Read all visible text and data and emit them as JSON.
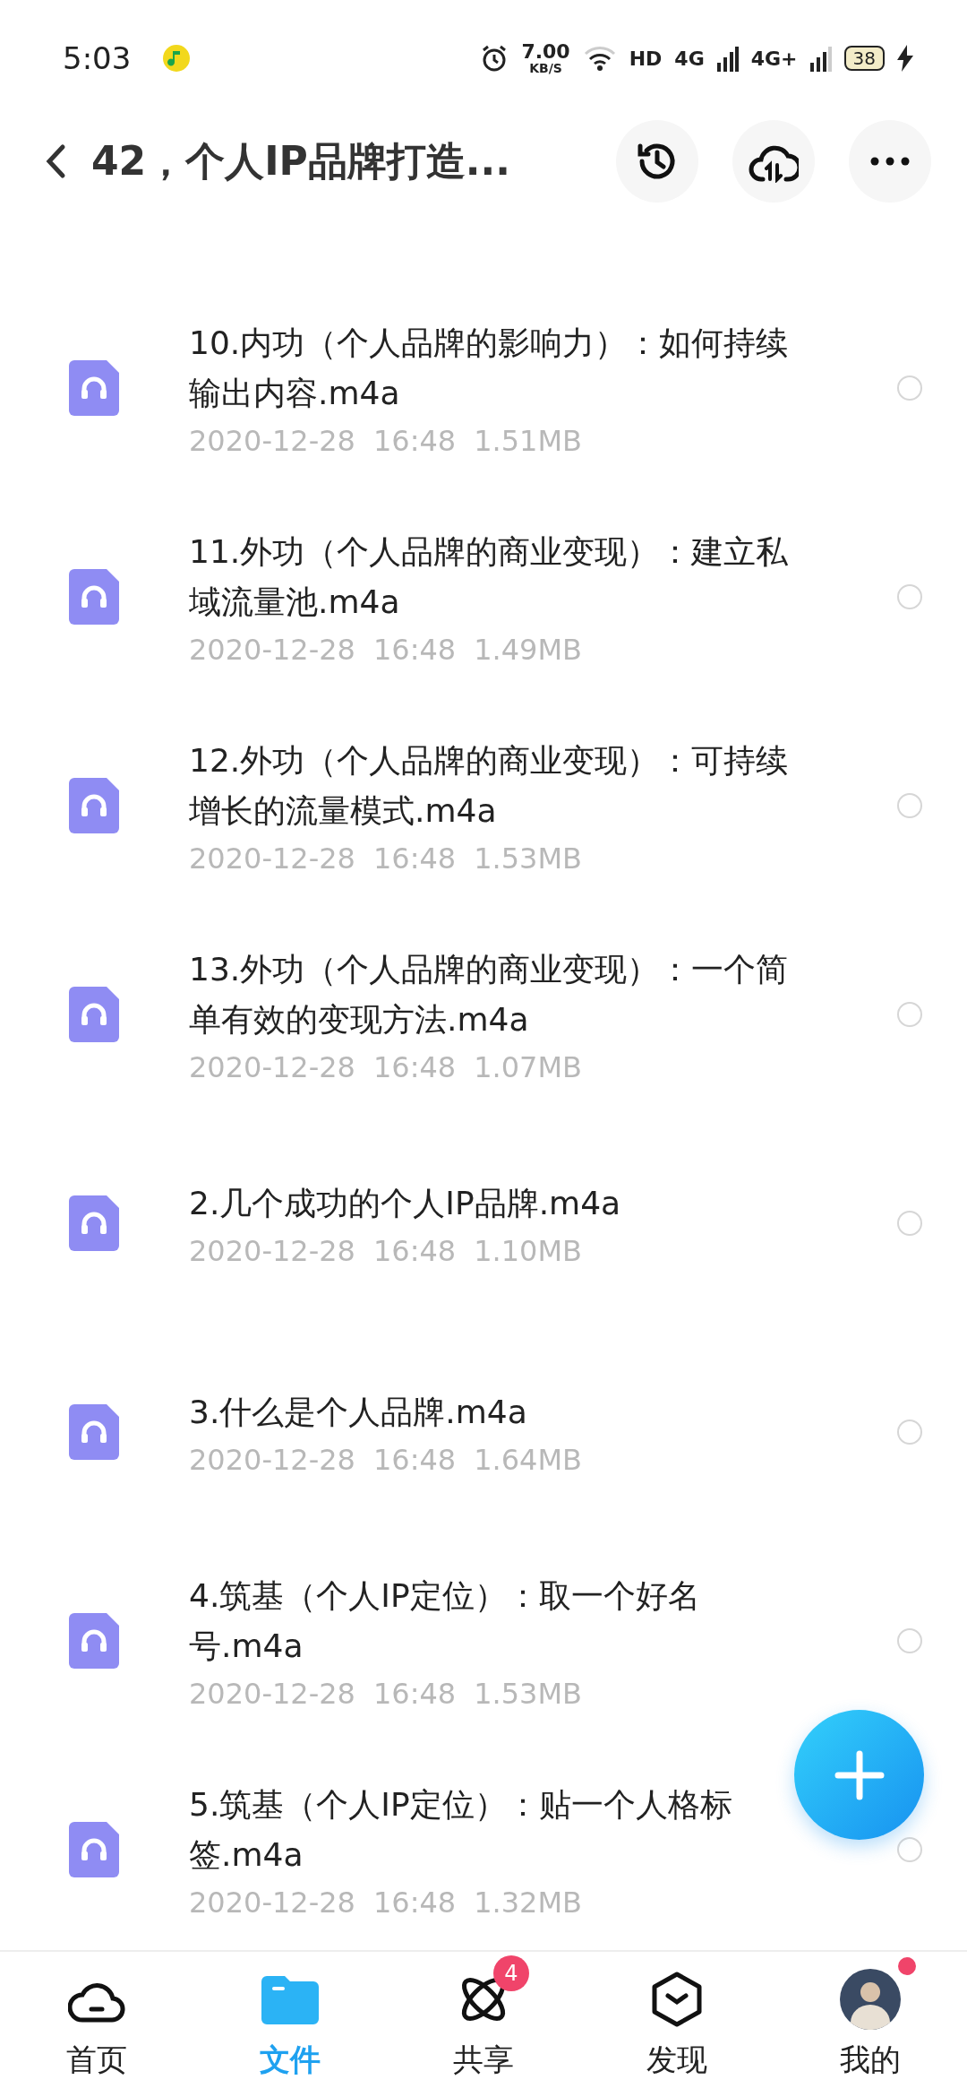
{
  "status_bar": {
    "time": "5:03",
    "net_speed": "7.00",
    "net_speed_unit": "KB/S",
    "hd": "HD",
    "network_1": "4G",
    "network_2": "4G+",
    "battery": "38",
    "charging": true
  },
  "header": {
    "title": "42，个人IP品牌打造..."
  },
  "files": [
    {
      "name": "10.内功（个人品牌的影响力）：如何持续输出内容.m4a",
      "date": "2020-12-28",
      "time": "16:48",
      "size": "1.51MB",
      "selected": false
    },
    {
      "name": "11.外功（个人品牌的商业变现）：建立私域流量池.m4a",
      "date": "2020-12-28",
      "time": "16:48",
      "size": "1.49MB",
      "selected": false
    },
    {
      "name": "12.外功（个人品牌的商业变现）：可持续增长的流量模式.m4a",
      "date": "2020-12-28",
      "time": "16:48",
      "size": "1.53MB",
      "selected": false
    },
    {
      "name": "13.外功（个人品牌的商业变现）：一个简单有效的变现方法.m4a",
      "date": "2020-12-28",
      "time": "16:48",
      "size": "1.07MB",
      "selected": false
    },
    {
      "name": "2.几个成功的个人IP品牌.m4a",
      "date": "2020-12-28",
      "time": "16:48",
      "size": "1.10MB",
      "selected": false
    },
    {
      "name": "3.什么是个人品牌.m4a",
      "date": "2020-12-28",
      "time": "16:48",
      "size": "1.64MB",
      "selected": false
    },
    {
      "name": "4.筑基（个人IP定位）：取一个好名号.m4a",
      "date": "2020-12-28",
      "time": "16:48",
      "size": "1.53MB",
      "selected": false
    },
    {
      "name": "5.筑基（个人IP定位）：贴一个人格标签.m4a",
      "date": "2020-12-28",
      "time": "16:48",
      "size": "1.32MB",
      "selected": false
    }
  ],
  "nav": [
    {
      "kind": "home",
      "label": "首页",
      "selected": false
    },
    {
      "kind": "files",
      "label": "文件",
      "selected": true
    },
    {
      "kind": "share",
      "label": "共享",
      "selected": false,
      "badge": "4"
    },
    {
      "kind": "discover",
      "label": "发现",
      "selected": false
    },
    {
      "kind": "profile",
      "label": "我的",
      "selected": false,
      "dot": true
    }
  ]
}
